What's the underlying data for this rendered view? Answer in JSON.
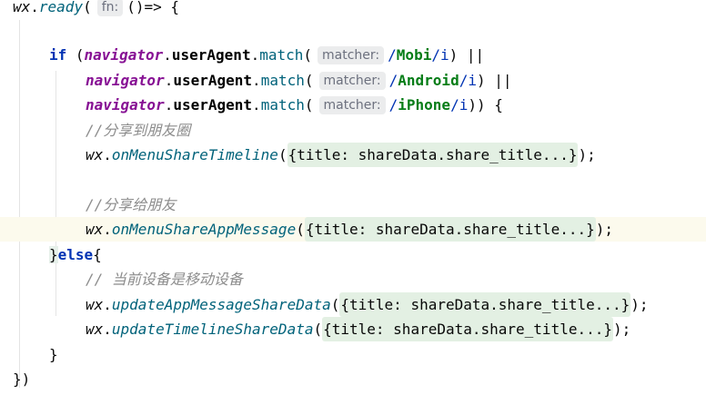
{
  "lines": {
    "l1": {
      "obj": "wx",
      "dot": ".",
      "method": "ready",
      "open": "(",
      "hint": "fn:",
      "rest": "()=> {"
    },
    "l3": {
      "kw": "if",
      "open": " (",
      "glob": "navigator",
      "dot1": ".",
      "prop": "userAgent",
      "dot2": ".",
      "method": "match",
      "paren": "(",
      "hint": "matcher:",
      "slash1": "/",
      "regex": "Mobi",
      "slash2": "/",
      "flag": "i",
      "close": ") ||"
    },
    "l4": {
      "glob": "navigator",
      "dot1": ".",
      "prop": "userAgent",
      "dot2": ".",
      "method": "match",
      "paren": "(",
      "hint": "matcher:",
      "slash1": "/",
      "regex": "Android",
      "slash2": "/",
      "flag": "i",
      "close": ") ||"
    },
    "l5": {
      "glob": "navigator",
      "dot1": ".",
      "prop": "userAgent",
      "dot2": ".",
      "method": "match",
      "paren": "(",
      "hint": "matcher:",
      "slash1": "/",
      "regex": "iPhone",
      "slash2": "/",
      "flag": "i",
      "close": ")) {"
    },
    "l6": {
      "comment": "//分享到朋友圈"
    },
    "l7": {
      "obj": "wx",
      "dot": ".",
      "method": "onMenuShareTimeline",
      "open": "(",
      "folded": "{title: shareData.share_title...}",
      "close": ");"
    },
    "l9": {
      "comment": "//分享给朋友"
    },
    "l10": {
      "obj": "wx",
      "dot": ".",
      "method": "onMenuShareAppMessage",
      "open": "(",
      "folded": "{title: shareData.share_title...}",
      "close": ");"
    },
    "l11": {
      "brace": "}",
      "kw": "else",
      "open": "{"
    },
    "l12": {
      "comment": "// 当前设备是移动设备"
    },
    "l13": {
      "obj": "wx",
      "dot": ".",
      "method": "updateAppMessageShareData",
      "open": "(",
      "folded": "{title: shareData.share_title...}",
      "close": ");"
    },
    "l14": {
      "obj": "wx",
      "dot": ".",
      "method": "updateTimelineShareData",
      "open": "(",
      "folded": "{title: shareData.share_title...}",
      "close": ");"
    },
    "l15": {
      "brace": "}"
    },
    "l16": {
      "close": "})"
    }
  }
}
